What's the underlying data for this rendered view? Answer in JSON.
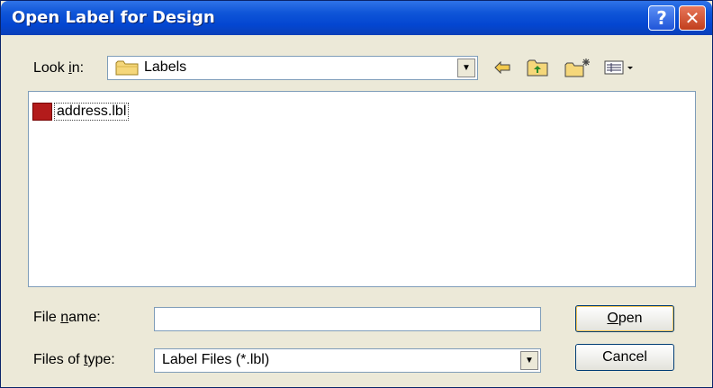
{
  "dialog": {
    "title": "Open Label for Design"
  },
  "titlebar": {
    "help_glyph": "?",
    "close_glyph": "✕"
  },
  "lookin": {
    "label_pre": "Look ",
    "label_accel": "i",
    "label_post": "n:",
    "value": "Labels",
    "folder_icon": "folder-icon"
  },
  "toolbar": {
    "back_icon": "back-arrow-icon",
    "up_icon": "up-one-level-icon",
    "new_folder_icon": "new-folder-icon",
    "view_icon": "view-menu-icon"
  },
  "files": [
    {
      "name": "address.lbl",
      "icon": "label-file-icon"
    }
  ],
  "filename": {
    "label_pre": "File ",
    "label_accel": "n",
    "label_post": "ame:",
    "value": ""
  },
  "filetype": {
    "label_pre": "Files of ",
    "label_accel": "t",
    "label_post": "ype:",
    "value": "Label Files (*.lbl)"
  },
  "buttons": {
    "open_accel": "O",
    "open_rest": "pen",
    "cancel": "Cancel"
  },
  "colors": {
    "titlebar": "#0346d1",
    "dialog_bg": "#ece9d8",
    "file_icon": "#b31b1b"
  }
}
